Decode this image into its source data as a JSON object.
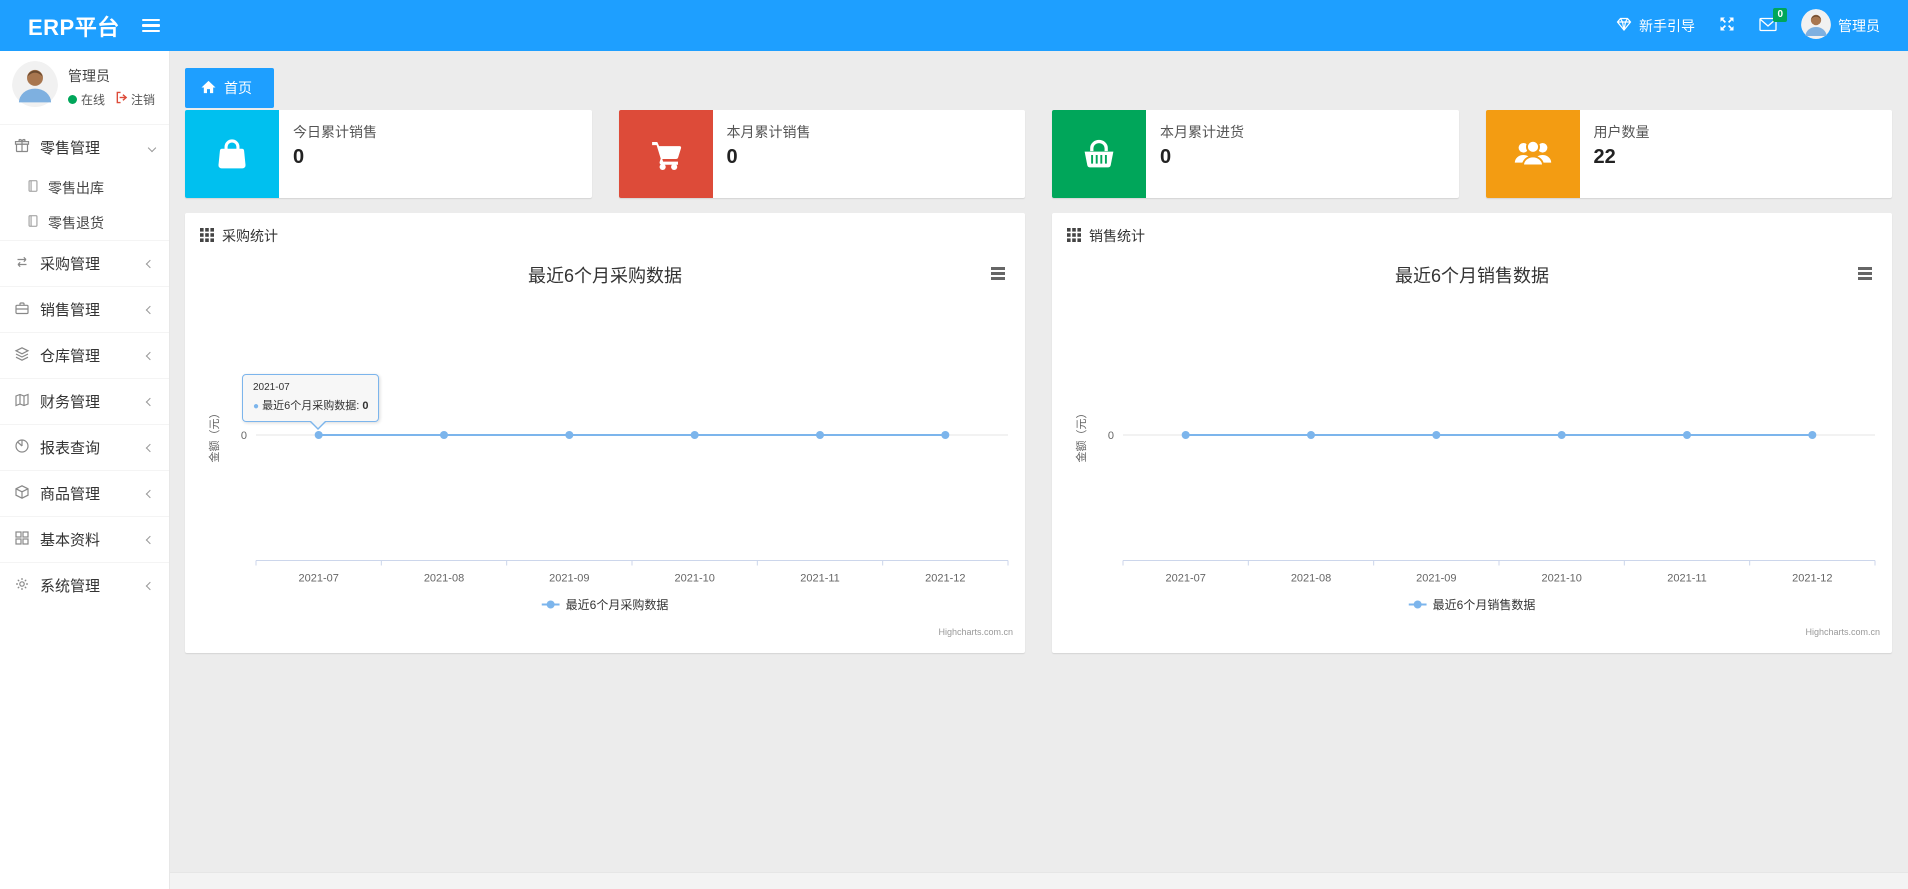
{
  "colors": {
    "accent": "#1e9fff",
    "green": "#00a65a",
    "chart_line": "#7cb5ec",
    "logout_red": "#dd4b39"
  },
  "navbar": {
    "brand": "ERP平台",
    "guide_label": "新手引导",
    "mail_badge": "0",
    "username": "管理员"
  },
  "sidebar": {
    "user": {
      "name": "管理员",
      "status": "在线",
      "logout": "注销"
    },
    "items": [
      {
        "label": "零售管理",
        "icon": "gift-icon",
        "expanded": true,
        "children": [
          "零售出库",
          "零售退货"
        ]
      },
      {
        "label": "采购管理",
        "icon": "exchange-icon"
      },
      {
        "label": "销售管理",
        "icon": "briefcase-icon"
      },
      {
        "label": "仓库管理",
        "icon": "layers-icon"
      },
      {
        "label": "财务管理",
        "icon": "map-icon"
      },
      {
        "label": "报表查询",
        "icon": "pie-chart-icon"
      },
      {
        "label": "商品管理",
        "icon": "cube-icon"
      },
      {
        "label": "基本资料",
        "icon": "grid-icon"
      },
      {
        "label": "系统管理",
        "icon": "gear-icon"
      }
    ]
  },
  "tabs": {
    "home": "首页"
  },
  "stat_cards": [
    {
      "label": "今日累计销售",
      "value": "0",
      "color": "#00c0ef",
      "icon": "bag-icon"
    },
    {
      "label": "本月累计销售",
      "value": "0",
      "color": "#dd4b39",
      "icon": "cart-icon"
    },
    {
      "label": "本月累计进货",
      "value": "0",
      "color": "#00a65a",
      "icon": "basket-icon"
    },
    {
      "label": "用户数量",
      "value": "22",
      "color": "#f39c12",
      "icon": "users-icon"
    }
  ],
  "chart_data": [
    {
      "type": "line",
      "panel_title": "采购统计",
      "title": "最近6个月采购数据",
      "categories": [
        "2021-07",
        "2021-08",
        "2021-09",
        "2021-10",
        "2021-11",
        "2021-12"
      ],
      "series": [
        {
          "name": "最近6个月采购数据",
          "values": [
            0,
            0,
            0,
            0,
            0,
            0
          ]
        }
      ],
      "xlabel": "",
      "ylabel": "金额（元）",
      "y_tick": "0",
      "ylim": [
        0,
        0
      ],
      "grid": true,
      "legend_position": "bottom",
      "line_color": "#7cb5ec",
      "credits": "Highcharts.com.cn",
      "tooltip": {
        "visible": true,
        "category": "2021-07",
        "series_label": "最近6个月采购数据:",
        "value": "0"
      }
    },
    {
      "type": "line",
      "panel_title": "销售统计",
      "title": "最近6个月销售数据",
      "categories": [
        "2021-07",
        "2021-08",
        "2021-09",
        "2021-10",
        "2021-11",
        "2021-12"
      ],
      "series": [
        {
          "name": "最近6个月销售数据",
          "values": [
            0,
            0,
            0,
            0,
            0,
            0
          ]
        }
      ],
      "xlabel": "",
      "ylabel": "金额（元）",
      "y_tick": "0",
      "ylim": [
        0,
        0
      ],
      "grid": true,
      "legend_position": "bottom",
      "line_color": "#7cb5ec",
      "credits": "Highcharts.com.cn",
      "tooltip": {
        "visible": false
      }
    }
  ]
}
